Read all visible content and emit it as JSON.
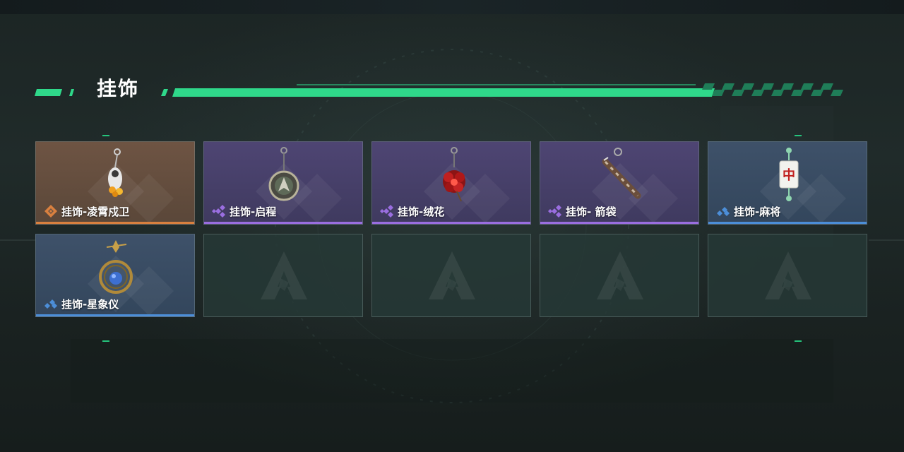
{
  "section": {
    "title": "挂饰"
  },
  "colors": {
    "accent_green": "#2fd88a",
    "rarity_orange": "#d9803f",
    "rarity_purple": "#9a6ee0",
    "rarity_blue": "#4c8ed8"
  },
  "slots": [
    {
      "name": "挂饰-凌霄戍卫",
      "rarity": "orange",
      "icon": "guardian-charm-icon"
    },
    {
      "name": "挂饰-启程",
      "rarity": "purple",
      "icon": "compass-medallion-icon"
    },
    {
      "name": "挂饰-绒花",
      "rarity": "purple",
      "icon": "red-flower-charm-icon"
    },
    {
      "name": "挂饰- 箭袋",
      "rarity": "purple",
      "icon": "quiver-charm-icon"
    },
    {
      "name": "挂饰-麻将",
      "rarity": "blue",
      "icon": "mahjong-tile-charm-icon"
    },
    {
      "name": "挂饰-星象仪",
      "rarity": "blue",
      "icon": "armillary-sphere-charm-icon"
    },
    {
      "empty": true,
      "icon": "empty-slot-logo-icon"
    },
    {
      "empty": true,
      "icon": "empty-slot-logo-icon"
    },
    {
      "empty": true,
      "icon": "empty-slot-logo-icon"
    },
    {
      "empty": true,
      "icon": "empty-slot-logo-icon"
    }
  ]
}
